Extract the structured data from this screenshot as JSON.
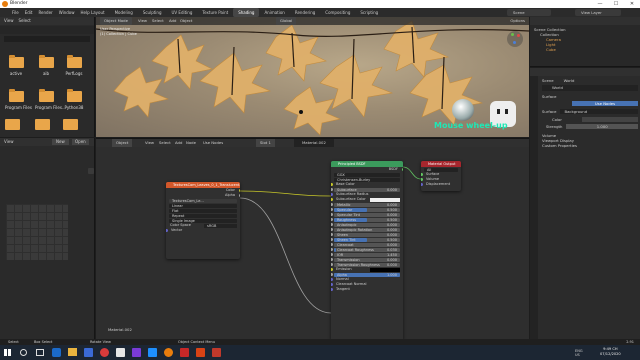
{
  "window": {
    "title": "Blender",
    "min": "—",
    "max": "☐",
    "close": "✕"
  },
  "menu": [
    "File",
    "Edit",
    "Render",
    "Window",
    "Help"
  ],
  "workspaces": [
    "Layout",
    "Modeling",
    "Sculpting",
    "UV Editing",
    "Texture Paint",
    "Shading",
    "Animation",
    "Rendering",
    "Compositing",
    "Scripting"
  ],
  "active_workspace": "Shading",
  "scene": "Scene",
  "view_layer": "View Layer",
  "file_browser": {
    "header": [
      "View",
      "Select"
    ],
    "folders": [
      {
        "name": "active"
      },
      {
        "name": "aib"
      },
      {
        "name": "PerfLogs"
      },
      {
        "name": "Program Files"
      },
      {
        "name": "Program Files..."
      },
      {
        "name": "Python38"
      }
    ]
  },
  "viewport": {
    "mode": "Object Mode",
    "menus": [
      "View",
      "Select",
      "Add",
      "Object"
    ],
    "info_lines": [
      "User Perspective",
      "(1) Collection | Cube"
    ],
    "transform": "Global",
    "overlay_text": "Mouse wheel-up",
    "options": "Options"
  },
  "outliner": {
    "items": [
      "Scene Collection",
      "Collection",
      "Camera",
      "Light",
      "Cube"
    ]
  },
  "properties": {
    "world_tab": "Scene",
    "world_name": "World",
    "surface_label": "Surface",
    "use_nodes": "Use Nodes",
    "surface_value": "Background",
    "color_label": "Color",
    "strength_label": "Strength",
    "strength_value": "1.000",
    "panels": [
      "Volume",
      "Viewport Display",
      "Custom Properties"
    ]
  },
  "image_editor": {
    "header": [
      "View"
    ],
    "new": "New",
    "open": "Open"
  },
  "node_editor": {
    "header_left": [
      "Object"
    ],
    "menus": [
      "View",
      "Select",
      "Add",
      "Node"
    ],
    "use_nodes": "Use Nodes",
    "slot": "Slot 1",
    "material": "Material.002",
    "footer": "Material.002"
  },
  "image_node": {
    "title": "TexturesCom_Leaves_0_1_Translucent.png",
    "out_color": "Color",
    "out_alpha": "Alpha",
    "image": "TexturesCom_Le...",
    "options": [
      "Linear",
      "Flat",
      "Repeat",
      "Single Image"
    ],
    "color_space_label": "Color Space",
    "color_space": "sRGB",
    "vector": "Vector"
  },
  "bsdf": {
    "title": "Principled BSDF",
    "output": "BSDF",
    "distribution": "GGX",
    "sss_method": "Christensen-Burley",
    "rows": [
      {
        "label": "Base Color",
        "kind": "socket"
      },
      {
        "label": "Subsurface",
        "value": "0.000",
        "fill": 0
      },
      {
        "label": "Subsurface Radius",
        "kind": "socket"
      },
      {
        "label": "Subsurface Color",
        "kind": "color"
      },
      {
        "label": "Metallic",
        "value": "0.000",
        "fill": 0
      },
      {
        "label": "Specular",
        "value": "0.500",
        "fill": 0.5
      },
      {
        "label": "Specular Tint",
        "value": "0.000",
        "fill": 0
      },
      {
        "label": "Roughness",
        "value": "0.500",
        "fill": 0.5
      },
      {
        "label": "Anisotropic",
        "value": "0.000",
        "fill": 0
      },
      {
        "label": "Anisotropic Rotation",
        "value": "0.000",
        "fill": 0
      },
      {
        "label": "Sheen",
        "value": "0.000",
        "fill": 0
      },
      {
        "label": "Sheen Tint",
        "value": "0.500",
        "fill": 0.5
      },
      {
        "label": "Clearcoat",
        "value": "0.000",
        "fill": 0
      },
      {
        "label": "Clearcoat Roughness",
        "value": "0.030",
        "fill": 0.03
      },
      {
        "label": "IOR",
        "value": "1.450",
        "fill": 0
      },
      {
        "label": "Transmission",
        "value": "0.000",
        "fill": 0
      },
      {
        "label": "Transmission Roughness",
        "value": "0.000",
        "fill": 0
      },
      {
        "label": "Emission",
        "kind": "black"
      },
      {
        "label": "Alpha",
        "value": "1.000",
        "fill": 1
      },
      {
        "label": "Normal",
        "kind": "socket"
      },
      {
        "label": "Clearcoat Normal",
        "kind": "socket"
      },
      {
        "label": "Tangent",
        "kind": "socket"
      }
    ]
  },
  "output_node": {
    "title": "Material Output",
    "target": "All",
    "inputs": [
      "Surface",
      "Volume",
      "Displacement"
    ]
  },
  "status": {
    "left": [
      "Select",
      "Box Select",
      "Rotate View"
    ],
    "right": "Object Context Menu",
    "version": "2.91"
  },
  "taskbar": {
    "lang": "ENG\nUS",
    "time": "9:49 CH",
    "date": "07/12/2020"
  },
  "colors": {
    "accent": "#4772b3",
    "orange": "#e87d0d",
    "shader_header": "#3b9a5c",
    "output_header": "#a6262d",
    "texture_header": "#d2572a"
  }
}
